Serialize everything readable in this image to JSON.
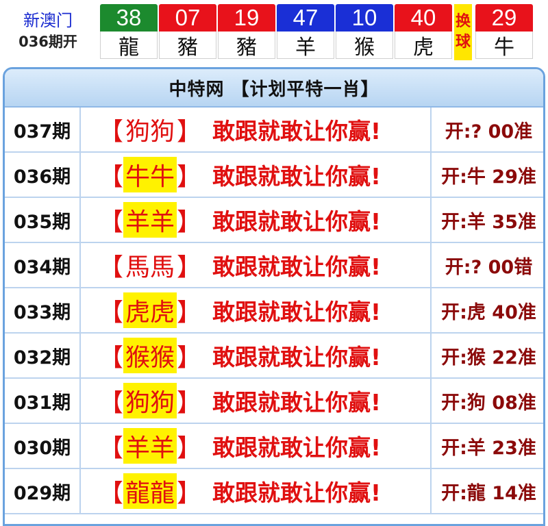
{
  "header": {
    "site": "新澳门",
    "issue": "036期开",
    "swap_label": [
      "换",
      "球"
    ],
    "balls": [
      {
        "number": "38",
        "zodiac": "龍",
        "color": "#1c8a2e"
      },
      {
        "number": "07",
        "zodiac": "豬",
        "color": "#e8121b"
      },
      {
        "number": "19",
        "zodiac": "豬",
        "color": "#e8121b"
      },
      {
        "number": "47",
        "zodiac": "羊",
        "color": "#1a2fd6"
      },
      {
        "number": "10",
        "zodiac": "猴",
        "color": "#1a2fd6"
      },
      {
        "number": "40",
        "zodiac": "虎",
        "color": "#e8121b"
      },
      {
        "number": "29",
        "zodiac": "牛",
        "color": "#e8121b"
      }
    ]
  },
  "table": {
    "title": "中特网 【计划平特一肖】",
    "rows": [
      {
        "issue": "037期",
        "pick": "狗狗",
        "highlight": false,
        "slogan": "敢跟就敢让你赢!",
        "result": "开:? 00准"
      },
      {
        "issue": "036期",
        "pick": "牛牛",
        "highlight": true,
        "slogan": "敢跟就敢让你赢!",
        "result": "开:牛 29准"
      },
      {
        "issue": "035期",
        "pick": "羊羊",
        "highlight": true,
        "slogan": "敢跟就敢让你赢!",
        "result": "开:羊 35准"
      },
      {
        "issue": "034期",
        "pick": "馬馬",
        "highlight": false,
        "slogan": "敢跟就敢让你赢!",
        "result": "开:? 00错"
      },
      {
        "issue": "033期",
        "pick": "虎虎",
        "highlight": true,
        "slogan": "敢跟就敢让你赢!",
        "result": "开:虎 40准"
      },
      {
        "issue": "032期",
        "pick": "猴猴",
        "highlight": true,
        "slogan": "敢跟就敢让你赢!",
        "result": "开:猴 22准"
      },
      {
        "issue": "031期",
        "pick": "狗狗",
        "highlight": true,
        "slogan": "敢跟就敢让你赢!",
        "result": "开:狗 08准"
      },
      {
        "issue": "030期",
        "pick": "羊羊",
        "highlight": true,
        "slogan": "敢跟就敢让你赢!",
        "result": "开:羊 23准"
      },
      {
        "issue": "029期",
        "pick": "龍龍",
        "highlight": true,
        "slogan": "敢跟就敢让你赢!",
        "result": "开:龍 14准"
      }
    ]
  }
}
